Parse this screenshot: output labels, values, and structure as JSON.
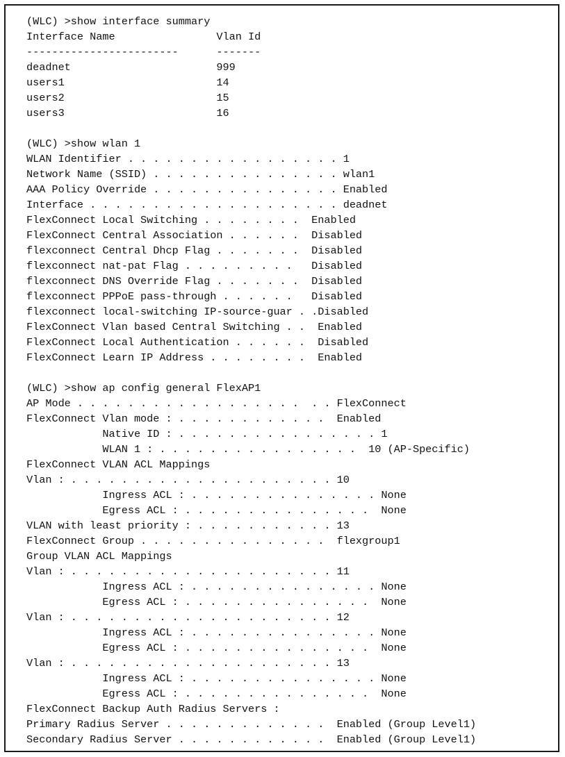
{
  "terminal": {
    "prompt": "(WLC) >",
    "blocks": [
      {
        "command": "(WLC) >show interface summary",
        "table": {
          "headers": [
            "Interface Name",
            "Vlan Id"
          ],
          "header_line": "Interface Name                Vlan Id",
          "separator_line": "------------------------      -------",
          "rows": [
            {
              "interface_name": "deadnet",
              "vlan_id": "999",
              "line": "deadnet                       999"
            },
            {
              "interface_name": "users1",
              "vlan_id": "14",
              "line": "users1                        14"
            },
            {
              "interface_name": "users2",
              "vlan_id": "15",
              "line": "users2                        15"
            },
            {
              "interface_name": "users3",
              "vlan_id": "16",
              "line": "users3                        16"
            }
          ]
        }
      },
      {
        "command": "(WLC) >show wlan 1",
        "fields": [
          {
            "label": "WLAN Identifier",
            "value": "1",
            "line": "WLAN Identifier . . . . . . . . . . . . . . . . . 1"
          },
          {
            "label": "Network Name (SSID)",
            "value": "wlan1",
            "line": "Network Name (SSID) . . . . . . . . . . . . . . . wlan1"
          },
          {
            "label": "AAA Policy Override",
            "value": "Enabled",
            "line": "AAA Policy Override . . . . . . . . . . . . . . . Enabled"
          },
          {
            "label": "Interface",
            "value": "deadnet",
            "line": "Interface . . . . . . . . . . . . . . . . . . . . deadnet"
          },
          {
            "label": "FlexConnect Local Switching",
            "value": "Enabled",
            "line": "FlexConnect Local Switching . . . . . . . .  Enabled"
          },
          {
            "label": "FlexConnect Central Association",
            "value": "Disabled",
            "line": "FlexConnect Central Association . . . . . .  Disabled"
          },
          {
            "label": "flexconnect Central Dhcp Flag",
            "value": "Disabled",
            "line": "flexconnect Central Dhcp Flag . . . . . . .  Disabled"
          },
          {
            "label": "flexconnect nat-pat Flag",
            "value": "Disabled",
            "line": "flexconnect nat-pat Flag . . . . . . . . .   Disabled"
          },
          {
            "label": "flexconnect DNS Override Flag",
            "value": "Disabled",
            "line": "flexconnect DNS Override Flag . . . . . . .  Disabled"
          },
          {
            "label": "flexconnect PPPoE pass-through",
            "value": "Disabled",
            "line": "flexconnect PPPoE pass-through . . . . . .   Disabled"
          },
          {
            "label": "flexconnect local-switching IP-source-guar",
            "value": "Disabled",
            "line": "flexconnect local-switching IP-source-guar . .Disabled"
          },
          {
            "label": "FlexConnect Vlan based Central Switching",
            "value": "Enabled",
            "line": "FlexConnect Vlan based Central Switching . .  Enabled"
          },
          {
            "label": "FlexConnect Local Authentication",
            "value": "Disabled",
            "line": "FlexConnect Local Authentication . . . . . .  Disabled"
          },
          {
            "label": "FlexConnect Learn IP Address",
            "value": "Enabled",
            "line": "FlexConnect Learn IP Address . . . . . . . .  Enabled"
          }
        ]
      },
      {
        "command": "(WLC) >show ap config general FlexAP1",
        "fields": [
          {
            "label": "AP Mode",
            "value": "FlexConnect",
            "line": "AP Mode . . . . . . . . . . . . . . . . . .  . . FlexConnect"
          },
          {
            "label": "FlexConnect Vlan mode :",
            "value": "Enabled",
            "line": "FlexConnect Vlan mode : . . . . . . . . . . . .  Enabled"
          },
          {
            "label": "Native ID :",
            "value": "1",
            "line": "            Native ID : . . . . . . . . . . . . . . . . 1"
          },
          {
            "label": "WLAN 1 :",
            "value": "10 (AP-Specific)",
            "line": "            WLAN 1 : . . . . . . . . . . . . . . . .  10 (AP-Specific)"
          },
          {
            "label": "FlexConnect VLAN ACL Mappings",
            "value": "",
            "line": "FlexConnect VLAN ACL Mappings"
          },
          {
            "label": "Vlan :",
            "value": "10",
            "line": "Vlan : . . . . . . . . . . . . . . . . . . . . . 10"
          },
          {
            "label": "Ingress ACL :",
            "value": "None",
            "line": "            Ingress ACL : . . . . . . . . . . . . . . . None"
          },
          {
            "label": "Egress ACL :",
            "value": "None",
            "line": "            Egress ACL : . . . . . . . . . . . . . . .  None"
          },
          {
            "label": "VLAN with least priority :",
            "value": "13",
            "line": "VLAN with least priority : . . . . . . . . . . . 13"
          },
          {
            "label": "FlexConnect Group",
            "value": "flexgroup1",
            "line": "FlexConnect Group . . . . . . . . . . . . . . .  flexgroup1"
          },
          {
            "label": "Group VLAN ACL Mappings",
            "value": "",
            "line": "Group VLAN ACL Mappings"
          },
          {
            "label": "Vlan :",
            "value": "11",
            "line": "Vlan : . . . . . . . . . . . . . . . . . . . . . 11"
          },
          {
            "label": "Ingress ACL :",
            "value": "None",
            "line": "            Ingress ACL : . . . . . . . . . . . . . . . None"
          },
          {
            "label": "Egress ACL :",
            "value": "None",
            "line": "            Egress ACL : . . . . . . . . . . . . . . .  None"
          },
          {
            "label": "Vlan :",
            "value": "12",
            "line": "Vlan : . . . . . . . . . . . . . . . . . . . . . 12"
          },
          {
            "label": "Ingress ACL :",
            "value": "None",
            "line": "            Ingress ACL : . . . . . . . . . . . . . . . None"
          },
          {
            "label": "Egress ACL :",
            "value": "None",
            "line": "            Egress ACL : . . . . . . . . . . . . . . .  None"
          },
          {
            "label": "Vlan :",
            "value": "13",
            "line": "Vlan : . . . . . . . . . . . . . . . . . . . . . 13"
          },
          {
            "label": "Ingress ACL :",
            "value": "None",
            "line": "            Ingress ACL : . . . . . . . . . . . . . . . None"
          },
          {
            "label": "Egress ACL :",
            "value": "None",
            "line": "            Egress ACL : . . . . . . . . . . . . . . .  None"
          },
          {
            "label": "FlexConnect Backup Auth Radius Servers :",
            "value": "",
            "line": "FlexConnect Backup Auth Radius Servers :"
          },
          {
            "label": "Primary Radius Server",
            "value": "Enabled (Group Level1)",
            "line": "Primary Radius Server . . . . . . . . . . . . .  Enabled (Group Level1)"
          },
          {
            "label": "Secondary Radius Server",
            "value": "Enabled (Group Level1)",
            "line": "Secondary Radius Server . . . . . . . . . . . .  Enabled (Group Level1)"
          }
        ]
      }
    ],
    "all_lines": [
      "(WLC) >show interface summary",
      "Interface Name                Vlan Id",
      "------------------------      -------",
      "deadnet                       999",
      "users1                        14",
      "users2                        15",
      "users3                        16",
      "",
      "(WLC) >show wlan 1",
      "WLAN Identifier . . . . . . . . . . . . . . . . . 1",
      "Network Name (SSID) . . . . . . . . . . . . . . . wlan1",
      "AAA Policy Override . . . . . . . . . . . . . . . Enabled",
      "Interface . . . . . . . . . . . . . . . . . . . . deadnet",
      "FlexConnect Local Switching . . . . . . . .  Enabled",
      "FlexConnect Central Association . . . . . .  Disabled",
      "flexconnect Central Dhcp Flag . . . . . . .  Disabled",
      "flexconnect nat-pat Flag . . . . . . . . .   Disabled",
      "flexconnect DNS Override Flag . . . . . . .  Disabled",
      "flexconnect PPPoE pass-through . . . . . .   Disabled",
      "flexconnect local-switching IP-source-guar . .Disabled",
      "FlexConnect Vlan based Central Switching . .  Enabled",
      "FlexConnect Local Authentication . . . . . .  Disabled",
      "FlexConnect Learn IP Address . . . . . . . .  Enabled",
      "",
      "(WLC) >show ap config general FlexAP1",
      "AP Mode . . . . . . . . . . . . . . . . . .  . . FlexConnect",
      "FlexConnect Vlan mode : . . . . . . . . . . . .  Enabled",
      "            Native ID : . . . . . . . . . . . . . . . . 1",
      "            WLAN 1 : . . . . . . . . . . . . . . . .  10 (AP-Specific)",
      "FlexConnect VLAN ACL Mappings",
      "Vlan : . . . . . . . . . . . . . . . . . . . . . 10",
      "            Ingress ACL : . . . . . . . . . . . . . . . None",
      "            Egress ACL : . . . . . . . . . . . . . . .  None",
      "VLAN with least priority : . . . . . . . . . . . 13",
      "FlexConnect Group . . . . . . . . . . . . . . .  flexgroup1",
      "Group VLAN ACL Mappings",
      "Vlan : . . . . . . . . . . . . . . . . . . . . . 11",
      "            Ingress ACL : . . . . . . . . . . . . . . . None",
      "            Egress ACL : . . . . . . . . . . . . . . .  None",
      "Vlan : . . . . . . . . . . . . . . . . . . . . . 12",
      "            Ingress ACL : . . . . . . . . . . . . . . . None",
      "            Egress ACL : . . . . . . . . . . . . . . .  None",
      "Vlan : . . . . . . . . . . . . . . . . . . . . . 13",
      "            Ingress ACL : . . . . . . . . . . . . . . . None",
      "            Egress ACL : . . . . . . . . . . . . . . .  None",
      "FlexConnect Backup Auth Radius Servers :",
      "Primary Radius Server . . . . . . . . . . . . .  Enabled (Group Level1)",
      "Secondary Radius Server . . . . . . . . . . . .  Enabled (Group Level1)"
    ]
  },
  "colors": {
    "text": "#111111",
    "background": "#ffffff",
    "border": "#1a1a1a"
  }
}
